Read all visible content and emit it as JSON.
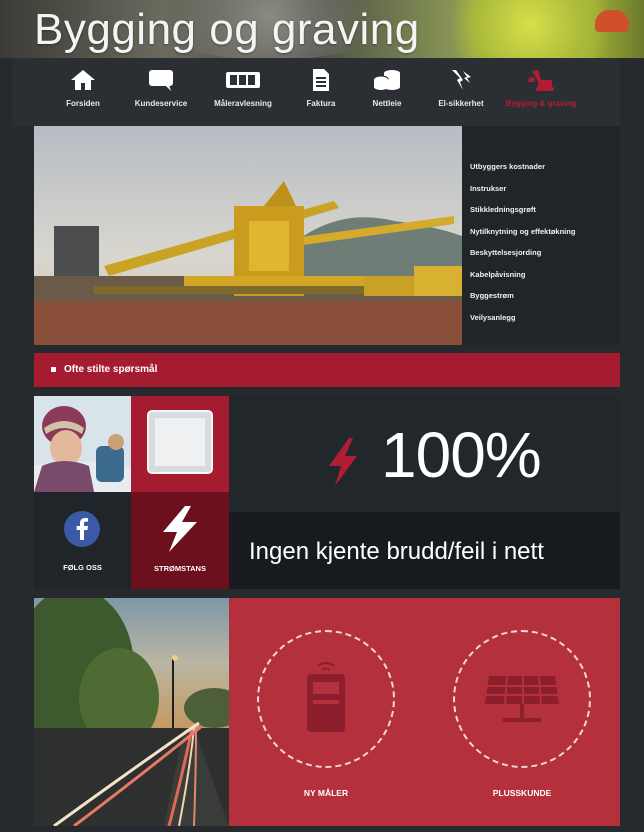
{
  "hero": {
    "title": "Bygging og graving"
  },
  "nav": {
    "items": [
      {
        "label": "Forsiden",
        "icon": "home-icon"
      },
      {
        "label": "Kundeservice",
        "icon": "chat-icon"
      },
      {
        "label": "Måleravlesning",
        "icon": "meter-icon"
      },
      {
        "label": "Faktura",
        "icon": "invoice-icon"
      },
      {
        "label": "Nettleie",
        "icon": "coins-icon"
      },
      {
        "label": "El-sikkerhet",
        "icon": "electric-safety-icon"
      },
      {
        "label": "Bygging & graving",
        "icon": "excavator-icon",
        "active": true
      }
    ]
  },
  "sidemenu": {
    "items": [
      "Utbyggers kostnader",
      "Instrukser",
      "Stikkledningsgrøft",
      "Nytilknytning og effektøkning",
      "Beskyttelsesjording",
      "Kabelpåvisning",
      "Byggestrøm",
      "Veilysanlegg"
    ]
  },
  "faq": {
    "label": "Ofte stilte spørsmål"
  },
  "tiles": {
    "follow_label": "FØLG OSS",
    "outage_label": "STRØMSTANS"
  },
  "status": {
    "percent": "100%",
    "message": "Ingen kjente brudd/feil i nett"
  },
  "services": {
    "new_meter_label": "NY MÅLER",
    "plus_customer_label": "PLUSSKUNDE"
  },
  "colors": {
    "accent": "#a51c30",
    "dark": "#262a2e",
    "panel": "#21252a",
    "red_tile": "#b4303d"
  }
}
